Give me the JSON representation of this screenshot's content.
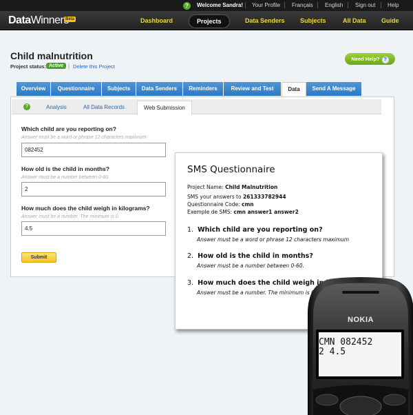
{
  "topbar": {
    "welcome": "Welcome Sandra!",
    "your_profile": "Your Profile",
    "lang_fr": "Français",
    "lang_en": "English",
    "sign_out": "Sign out",
    "help": "Help",
    "help_icon_glyph": "?"
  },
  "nav": {
    "logo_bold": "Data",
    "logo_thin": "Winners",
    "beta": "Beta",
    "items": [
      "Dashboard",
      "Projects",
      "Data Senders",
      "Subjects",
      "All Data",
      "Guide"
    ],
    "active": "Projects"
  },
  "project": {
    "title": "Child malnutrition",
    "status_label": "Project status:",
    "status": "Active",
    "separator": "|",
    "delete_link": "Delete this Project",
    "need_help": "Need Help?",
    "need_help_glyph": "?"
  },
  "tabs": [
    "Overview",
    "Questionnaire",
    "Subjects",
    "Data Senders",
    "Reminders",
    "Review and Test",
    "Data",
    "Send A Message"
  ],
  "active_tab": "Data",
  "subtabs": {
    "help_glyph": "?",
    "items": [
      "Analysis",
      "All Data Records",
      "Web Submission"
    ],
    "active": "Web Submission"
  },
  "form": {
    "questions": [
      {
        "label": "Which child are you reporting on?",
        "hint": "Answer must be a word or phrase 12 characters maximum",
        "value": "082452"
      },
      {
        "label": "How old is the child in months?",
        "hint": "Answer must be a number between 0-60.",
        "value": "2"
      },
      {
        "label": "How much does the child weigh in kilograms?",
        "hint": "Answer must be a number. The minimum is 0.",
        "value": "4.5"
      }
    ],
    "submit": "Submit"
  },
  "sms": {
    "title": "SMS Questionnaire",
    "project_name_label": "Project Name:",
    "project_name": "Child Malnutrition",
    "answers_to_label": "SMS your answers to",
    "answers_to": "261333782944",
    "code_label": "Questionnaire Code:",
    "code": "cmn",
    "example_label": "Exemple de SMS:",
    "example": "cmn answer1 answer2",
    "questions": [
      {
        "num": "1.",
        "text": "Which child are you reporting on?",
        "hint": "Answer must be a word or phrase 12 characters maximum"
      },
      {
        "num": "2.",
        "text": "How old is the child in months?",
        "hint": "Answer must be a number between 0-60."
      },
      {
        "num": "3.",
        "text": "How much does the child weigh in kilograms?",
        "hint": "Answer must be a number. The minimum is 0."
      }
    ]
  },
  "phone": {
    "brand": "NOKIA",
    "screen_line1": "CMN 082452",
    "screen_line2": "2 4.5",
    "body_color": "#1c1c1c",
    "screen_color": "#f4f6f4"
  }
}
